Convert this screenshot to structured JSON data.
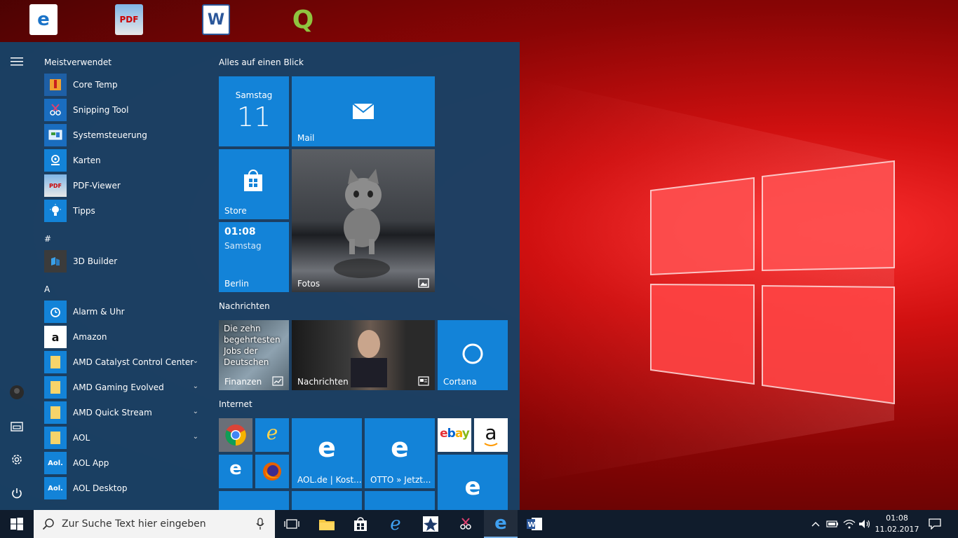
{
  "desktop": {
    "icons": [
      {
        "name": "edge-shortcut-icon"
      },
      {
        "name": "pdf-viewer-shortcut-icon",
        "text": "PDF"
      },
      {
        "name": "word-shortcut-icon",
        "text": "W"
      },
      {
        "name": "qgis-shortcut-icon",
        "text": "Q"
      }
    ]
  },
  "start_menu": {
    "most_used_header": "Meistverwendet",
    "most_used": [
      {
        "label": "Core Temp",
        "icon": "core-temp-icon"
      },
      {
        "label": "Snipping Tool",
        "icon": "scissors-icon"
      },
      {
        "label": "Systemsteuerung",
        "icon": "control-panel-icon"
      },
      {
        "label": "Karten",
        "icon": "maps-icon"
      },
      {
        "label": "PDF-Viewer",
        "icon": "pdf-icon"
      },
      {
        "label": "Tipps",
        "icon": "lightbulb-icon"
      }
    ],
    "hash_header": "#",
    "hash_apps": [
      {
        "label": "3D Builder",
        "icon": "3d-builder-icon"
      }
    ],
    "a_header": "A",
    "a_apps": [
      {
        "label": "Alarm & Uhr",
        "icon": "alarm-icon"
      },
      {
        "label": "Amazon",
        "icon": "amazon-icon",
        "glyph": "a"
      },
      {
        "label": "AMD Catalyst Control Center",
        "icon": "folder-icon",
        "expandable": true
      },
      {
        "label": "AMD Gaming Evolved",
        "icon": "folder-icon",
        "expandable": true
      },
      {
        "label": "AMD Quick Stream",
        "icon": "folder-icon",
        "expandable": true
      },
      {
        "label": "AOL",
        "icon": "folder-icon",
        "expandable": true
      },
      {
        "label": "AOL App",
        "icon": "aol-icon",
        "glyph": "Aol."
      },
      {
        "label": "AOL Desktop",
        "icon": "aol-icon",
        "glyph": "Aol."
      }
    ],
    "groups": {
      "overview": "Alles auf einen Blick",
      "news": "Nachrichten",
      "internet": "Internet"
    },
    "tiles": {
      "calendar": {
        "day_name": "Samstag",
        "day_number": "11"
      },
      "mail": {
        "label": "Mail"
      },
      "store": {
        "label": "Store"
      },
      "weather": {
        "time": "01:08",
        "day": "Samstag",
        "city": "Berlin"
      },
      "photos": {
        "label": "Fotos"
      },
      "finance": {
        "headline": "Die zehn begehrtesten Jobs der Deutschen",
        "label": "Finanzen"
      },
      "news": {
        "label": "Nachrichten"
      },
      "cortana": {
        "label": "Cortana"
      },
      "aol": {
        "label": "AOL.de | Kost..."
      },
      "otto": {
        "label": "OTTO » Jetzt..."
      },
      "ebay": {
        "label": "ebay"
      },
      "amazon": {
        "label": "a"
      }
    }
  },
  "taskbar": {
    "search_placeholder": "Zur Suche Text hier eingeben",
    "clock_time": "01:08",
    "clock_date": "11.02.2017"
  }
}
